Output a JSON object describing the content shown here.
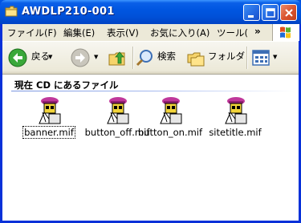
{
  "window": {
    "title": "AWDLP210-001"
  },
  "menu": [
    "ファイル(F)",
    "編集(E)",
    "表示(V)",
    "お気に入り(A)",
    "ツール("
  ],
  "menu_overflow": "»",
  "toolbar": {
    "back": "戻る",
    "search": "検索",
    "folders": "フォルダ"
  },
  "section": {
    "title": "現在 CD にあるファイル"
  },
  "files": [
    {
      "name": "banner.mif",
      "icon": "mif-file-icon",
      "selected": true
    },
    {
      "name": "button_off.mif",
      "icon": "mif-file-icon",
      "selected": false
    },
    {
      "name": "button_on.mif",
      "icon": "mif-file-icon",
      "selected": false
    },
    {
      "name": "sitetitle.mif",
      "icon": "mif-file-icon",
      "selected": false
    }
  ],
  "colors": {
    "titlebar": "#0054e3",
    "chrome": "#ece9d8",
    "close": "#d9522e"
  }
}
